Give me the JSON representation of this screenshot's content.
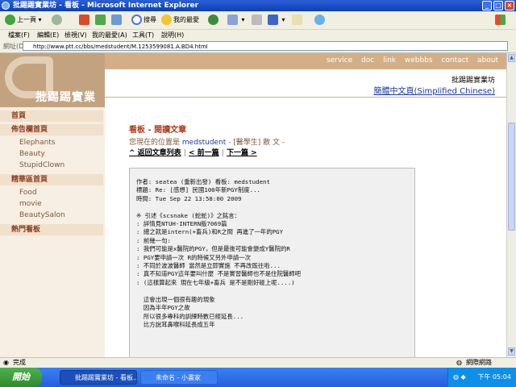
{
  "window": {
    "title": "批踢踢實業坊 - 看板 - Microsoft Internet Explorer"
  },
  "toolbar": {
    "back": "上一頁",
    "search": "搜尋",
    "favorites": "我的最愛"
  },
  "menu": [
    "檔案(F)",
    "編輯(E)",
    "檢視(V)",
    "我的最愛(A)",
    "工具(T)",
    "說明(H)"
  ],
  "address": {
    "label": "網址(D)",
    "url": "http://www.ptt.cc/bbs/medstudent/M.1253599081.A.BD4.html"
  },
  "site": {
    "logo_text": "批踢踢實業坊",
    "topnav": [
      "service",
      "doc",
      "link",
      "webbbs",
      "contact",
      "about"
    ],
    "name": "批踢踢實業坊",
    "simplified_link": "簡體中文頁(Simplified Chinese)"
  },
  "sidebar": {
    "home": "首頁",
    "bulletin_home": "佈告欄首頁",
    "bulletin_items": [
      "Elephants",
      "Beauty",
      "StupidClown"
    ],
    "featured_home": "精華區首頁",
    "featured_items": [
      "Food",
      "movie",
      "BeautySalon"
    ],
    "hot_boards": "熱門看板"
  },
  "main": {
    "board_title": "看板 - 閱讀文章",
    "location_prefix": "您現在的位置是",
    "location_board": "medstudent",
    "location_suffix": "- [醫學生] 散 文 -",
    "nav": {
      "back_to_list": "^ 返回文章列表",
      "prev": "< 前一篇",
      "next": "下一篇 >"
    },
    "article": "作者: seatea (重新出發) 看板: medstudent\n標題: Re: [感想] 民國100年新PGY制度...\n時間: Tue Sep 22 13:58:00 2009\n\n※ 引述《scsnake (蛇蛇)》之銘言：\n: 詳情見NTUH-INTERN版7069篇\n: 總之就是intern(+畜兵)和R之間 再進了一年的PGY\n: 前幾一句:\n: 我們可能是x醫院的PGY，但是最後可能會變成Y醫院的R\n: PGY要申請一次 R的時候又另外申請一次\n: 不同於波波醫師 當然是立即實施 不再改既往啦...\n: 真不知道PGY這年要叫什麼 不是實習醫師也不是住院醫師吧\n: (這樣算起來 現在七年級+畜兵 是不是剛好碰上呢....)\n\n  這會出現一個很有趣的現象\n  因為半年PGY之故\n  所以很多專科的訓練時數已經延長...\n  比方說耳鼻喉科延長成五年"
  },
  "statusbar": {
    "status": "完成",
    "zone": "網際網路"
  },
  "taskbar": {
    "start": "開始",
    "tasks": [
      "批踢踢實業坊 - 看板...",
      "未命名 - 小畫家"
    ],
    "clock": "下午 05:04"
  }
}
